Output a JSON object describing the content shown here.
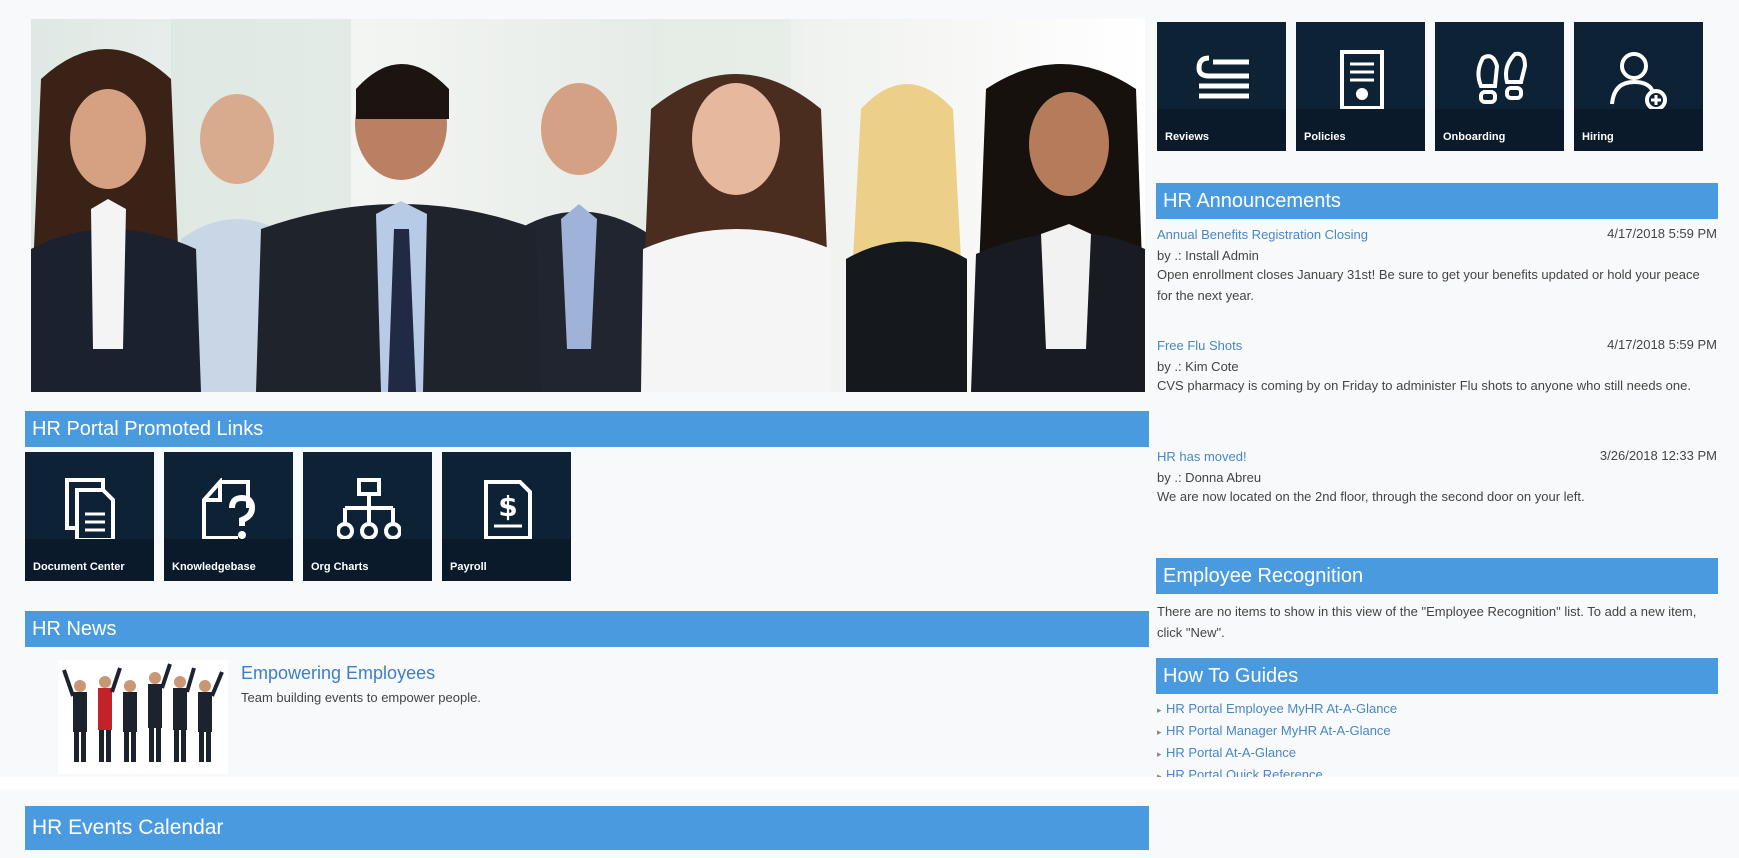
{
  "top_tiles": [
    {
      "label": "Reviews",
      "icon": "reviews-icon"
    },
    {
      "label": "Policies",
      "icon": "policies-icon"
    },
    {
      "label": "Onboarding",
      "icon": "onboarding-icon"
    },
    {
      "label": "Hiring",
      "icon": "hiring-icon"
    }
  ],
  "promoted_links": {
    "title": "HR Portal Promoted Links",
    "tiles": [
      {
        "label": "Document Center",
        "icon": "document-center-icon"
      },
      {
        "label": "Knowledgebase",
        "icon": "knowledgebase-icon"
      },
      {
        "label": "Org Charts",
        "icon": "org-charts-icon"
      },
      {
        "label": "Payroll",
        "icon": "payroll-icon"
      }
    ]
  },
  "news": {
    "title": "HR News",
    "item": {
      "headline": "Empowering Employees",
      "summary": "Team building events to empower people."
    }
  },
  "events": {
    "title": "HR Events Calendar"
  },
  "announcements": {
    "title": "HR Announcements",
    "items": [
      {
        "title": "Annual Benefits Registration Closing",
        "date": "4/17/2018 5:59 PM",
        "by": "by .: Install Admin",
        "body": "Open enrollment closes January 31st! Be sure to get your benefits updated or hold your peace for the next year."
      },
      {
        "title": "Free Flu Shots",
        "date": "4/17/2018 5:59 PM",
        "by": "by .: Kim Cote",
        "body": "CVS pharmacy is coming by on Friday to administer Flu shots to anyone who still needs one."
      },
      {
        "title": "HR has moved!",
        "date": "3/26/2018 12:33 PM",
        "by": "by .: Donna Abreu",
        "body": "We are now located on the 2nd floor, through the second door on your left."
      }
    ]
  },
  "recognition": {
    "title": "Employee Recognition",
    "empty_text": "There are no items to show in this view of the \"Employee Recognition\" list. To add a new item, click \"New\"."
  },
  "guides": {
    "title": "How To Guides",
    "items": [
      "HR Portal Employee MyHR At-A-Glance",
      "HR Portal Manager MyHR At-A-Glance",
      "HR Portal At-A-Glance",
      "HR Portal Quick Reference"
    ]
  },
  "colors": {
    "header_blue": "#4a9ae0",
    "tile_navy": "#0d2235",
    "link_blue": "#4a86c5"
  }
}
